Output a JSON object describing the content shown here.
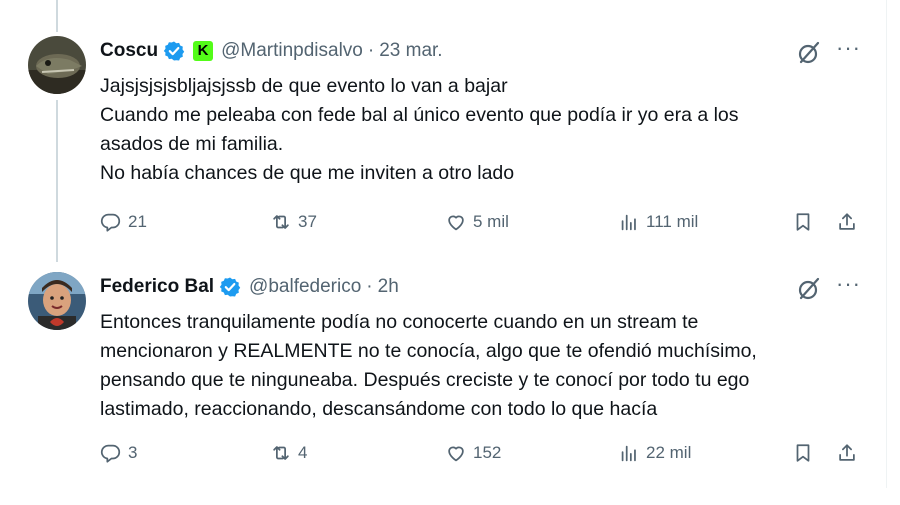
{
  "colors": {
    "text": "#0f1419",
    "secondary": "#536471",
    "verified": "#1d9bf0",
    "kick": "#53fc18",
    "thread": "#cfd9de"
  },
  "tweets": [
    {
      "name": "Coscu",
      "kick_letter": "K",
      "handle": "@Martinpdisalvo",
      "dot": "·",
      "time": "23 mar.",
      "lines": [
        "Jajsjsjsjsbljajsjssb de que evento lo van a bajar",
        "Cuando me peleaba con fede bal al único evento que podía ir yo era a los",
        "asados de mi familia.",
        "No había chances de que me inviten a otro lado"
      ],
      "stats": {
        "replies": "21",
        "reposts": "37",
        "likes": "5 mil",
        "views": "111 mil"
      },
      "more": "···"
    },
    {
      "name": "Federico Bal",
      "handle": "@balfederico",
      "dot": "·",
      "time": "2h",
      "lines": [
        "Entonces tranquilamente podía no conocerte cuando en un stream te",
        "mencionaron y REALMENTE no te conocía, algo que te ofendió muchísimo,",
        "pensando que te ninguneaba. Después creciste y te conocí por todo tu ego",
        "lastimado, reaccionando, descansándome con todo lo que hacía"
      ],
      "stats": {
        "replies": "3",
        "reposts": "4",
        "likes": "152",
        "views": "22 mil"
      },
      "more": "···"
    }
  ]
}
